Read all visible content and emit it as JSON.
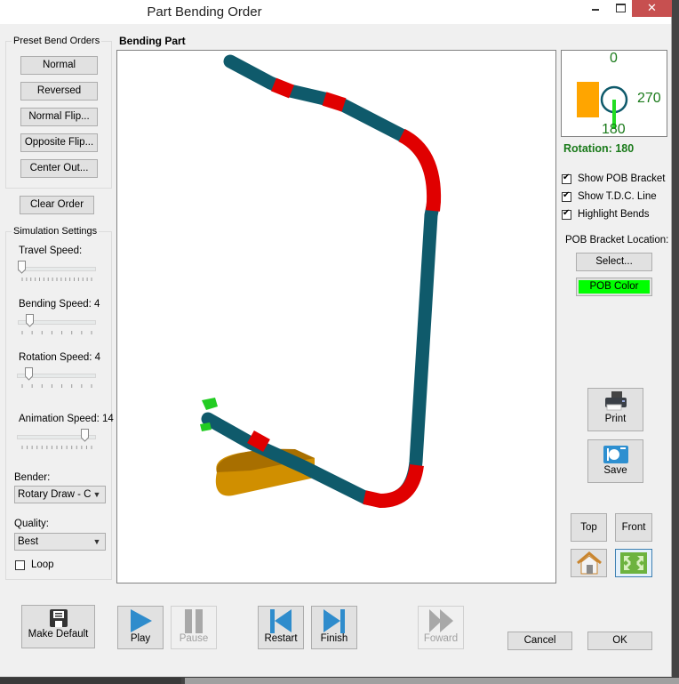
{
  "window": {
    "title": "Part Bending Order",
    "controls": {
      "minimize": "minimize",
      "maximize": "maximize",
      "close": "✕"
    }
  },
  "preset_bend_orders": {
    "legend": "Preset Bend Orders",
    "buttons": [
      "Normal",
      "Reversed",
      "Normal Flip...",
      "Opposite Flip...",
      "Center Out..."
    ]
  },
  "clear_order_label": "Clear Order",
  "simulation_settings": {
    "legend": "Simulation Settings",
    "travel_speed": {
      "label": "Travel Speed:",
      "value_fraction": 0.0
    },
    "bending_speed": {
      "label": "Bending Speed: 4",
      "value": 4,
      "value_fraction": 0.12
    },
    "rotation_speed": {
      "label": "Rotation Speed: 4",
      "value": 4,
      "value_fraction": 0.12
    },
    "animation_speed": {
      "label": "Animation Speed: 14",
      "value": 14,
      "value_fraction": 0.88
    },
    "bender": {
      "label": "Bender:",
      "selected": "Rotary Draw - Clo"
    },
    "quality": {
      "label": "Quality:",
      "selected": "Best"
    },
    "loop": {
      "label": "Loop",
      "checked": false
    }
  },
  "viewport": {
    "title": "Bending Part",
    "colors": {
      "tube": "#0f5a6b",
      "bend": "#e00000",
      "die": "#cc8a00",
      "bracket": "#22cc22"
    }
  },
  "rotation_dial": {
    "labels": {
      "top": "0",
      "right": "270",
      "bottom": "180"
    },
    "rotation_text": "Rotation: 180",
    "text_color": "#1a7a1a"
  },
  "options": {
    "show_pob_bracket": {
      "label": "Show POB Bracket",
      "checked": true
    },
    "show_tdc_line": {
      "label": "Show T.D.C. Line",
      "checked": true
    },
    "highlight_bends": {
      "label": "Highlight Bends",
      "checked": true
    },
    "pob_bracket_location_label": "POB Bracket Location:",
    "select_label": "Select...",
    "pob_color_label": "POB Color",
    "pob_color": "#00ff00"
  },
  "side_buttons": {
    "print": "Print",
    "save": "Save",
    "top": "Top",
    "front": "Front"
  },
  "bottom_bar": {
    "make_default": "Make Default",
    "play": "Play",
    "pause": "Pause",
    "restart": "Restart",
    "finish": "Finish",
    "forward": "Foward",
    "cancel": "Cancel",
    "ok": "OK"
  }
}
